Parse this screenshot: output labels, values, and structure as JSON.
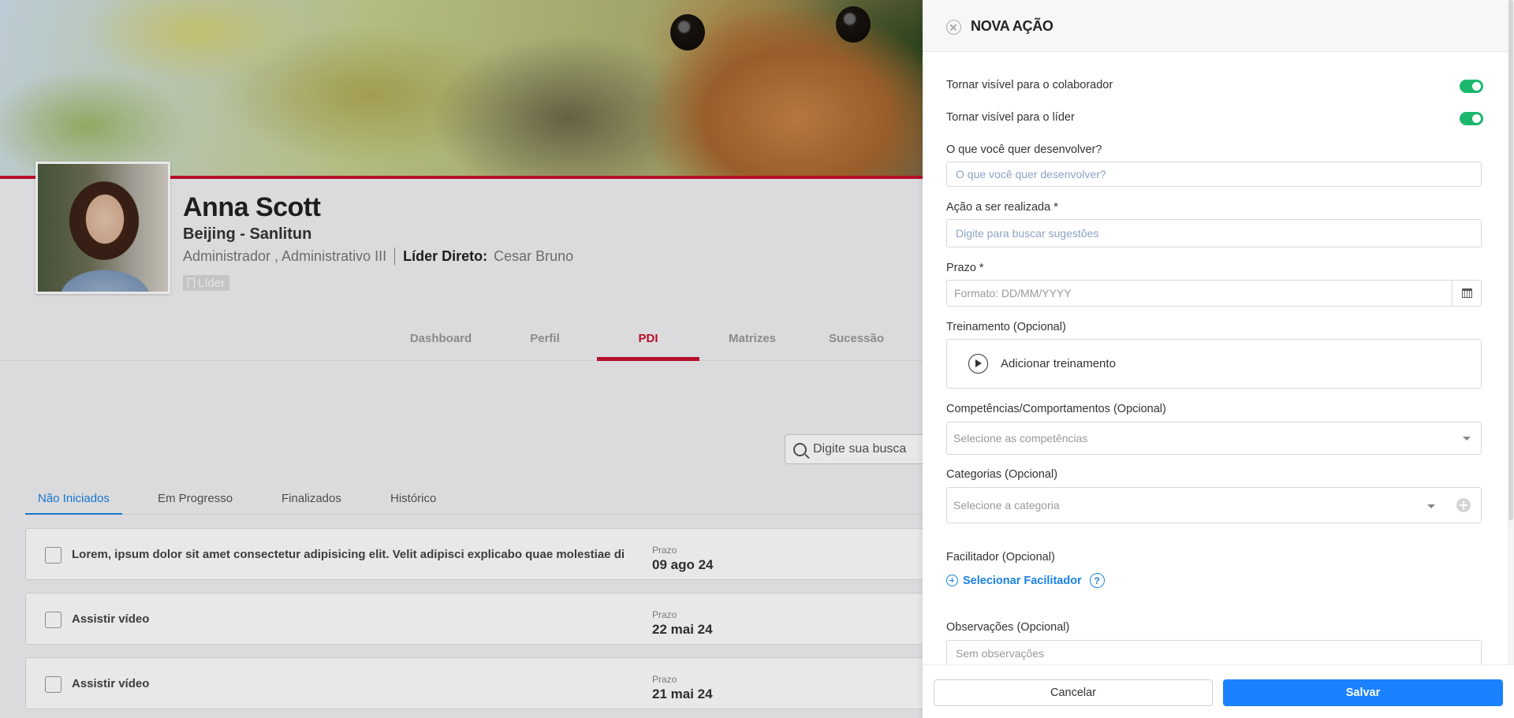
{
  "profile": {
    "name": "Anna Scott",
    "location": "Beijing - Sanlitun",
    "roles": "Administrador , Administrativo III",
    "leader_label": "Líder Direto:",
    "leader_name": "Cesar Bruno",
    "badge": "Líder"
  },
  "main_tabs": [
    "Dashboard",
    "Perfil",
    "PDI",
    "Matrizes",
    "Sucessão"
  ],
  "search": {
    "placeholder": "Digite sua busca"
  },
  "sub_tabs": [
    "Não Iniciados",
    "Em Progresso",
    "Finalizados",
    "Histórico"
  ],
  "actions": [
    {
      "title": "Lorem, ipsum dolor sit amet consectetur adipisicing elit. Velit adipisci explicabo quae molestiae di",
      "deadline_label": "Prazo",
      "deadline": "09 ago 24"
    },
    {
      "title": "Assistir vídeo",
      "deadline_label": "Prazo",
      "deadline": "22 mai 24"
    },
    {
      "title": "Assistir vídeo",
      "deadline_label": "Prazo",
      "deadline": "21 mai 24"
    }
  ],
  "drawer": {
    "title": "NOVA AÇÃO",
    "visible_collaborator": "Tornar visível para o colaborador",
    "visible_leader": "Tornar visível para o líder",
    "develop_label": "O que você quer desenvolver?",
    "develop_placeholder": "O que você quer desenvolver?",
    "action_label": "Ação a ser realizada *",
    "action_placeholder": "Digite para buscar sugestões",
    "deadline_label": "Prazo *",
    "deadline_placeholder": "Formato: DD/MM/YYYY",
    "training_label": "Treinamento (Opcional)",
    "training_add": "Adicionar treinamento",
    "competencies_label": "Competências/Comportamentos (Opcional)",
    "competencies_placeholder": "Selecione as competências",
    "categories_label": "Categorias (Opcional)",
    "categories_placeholder": "Selecione a categoria",
    "facilitator_label": "Facilitador (Opcional)",
    "facilitator_select": "Selecionar Facilitador",
    "help_glyph": "?",
    "notes_label": "Observações (Opcional)",
    "notes_placeholder": "Sem observações",
    "cancel": "Cancelar",
    "save": "Salvar"
  },
  "colors": {
    "brand_red": "#c8102e",
    "primary_blue": "#1a82ff",
    "toggle_green": "#1bb76e"
  }
}
